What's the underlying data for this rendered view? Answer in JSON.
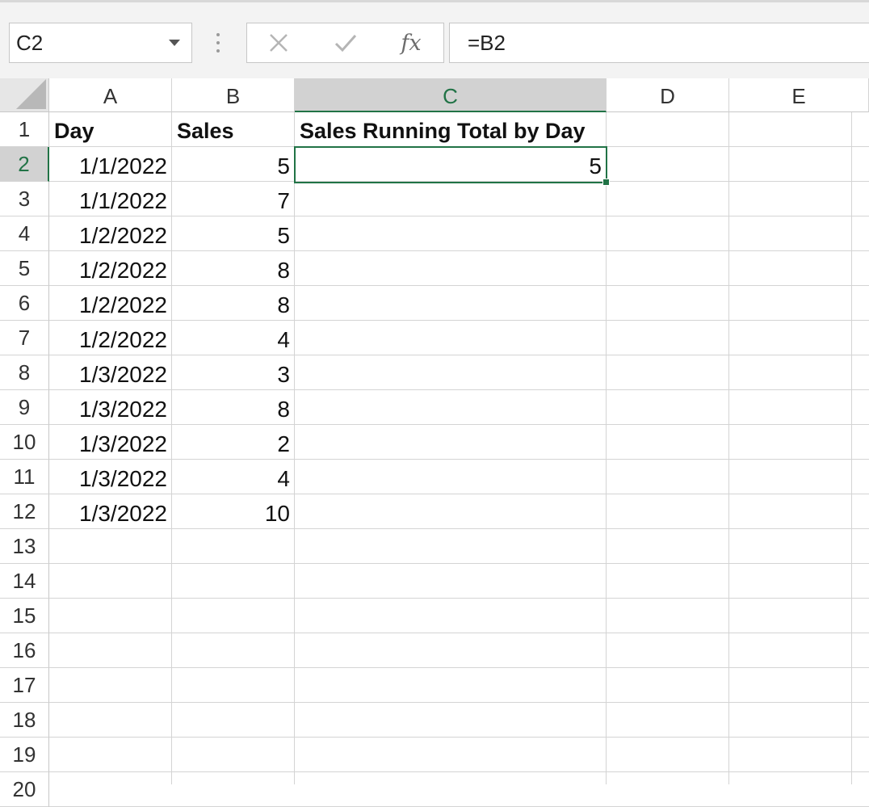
{
  "name_box": {
    "value": "C2"
  },
  "formula_bar": {
    "cancel_icon": "x-icon",
    "enter_icon": "check-icon",
    "fx_label": "fx",
    "formula": "=B2"
  },
  "columns": [
    "A",
    "B",
    "C",
    "D",
    "E"
  ],
  "selected_column": "C",
  "rows": [
    "1",
    "2",
    "3",
    "4",
    "5",
    "6",
    "7",
    "8",
    "9",
    "10",
    "11",
    "12",
    "13",
    "14",
    "15",
    "16",
    "17",
    "18",
    "19",
    "20"
  ],
  "selected_row": "2",
  "headers": {
    "A": "Day",
    "B": "Sales",
    "C": "Sales Running Total by Day"
  },
  "data": [
    {
      "day": "1/1/2022",
      "sales": "5",
      "total": "5"
    },
    {
      "day": "1/1/2022",
      "sales": "7",
      "total": ""
    },
    {
      "day": "1/2/2022",
      "sales": "5",
      "total": ""
    },
    {
      "day": "1/2/2022",
      "sales": "8",
      "total": ""
    },
    {
      "day": "1/2/2022",
      "sales": "8",
      "total": ""
    },
    {
      "day": "1/2/2022",
      "sales": "4",
      "total": ""
    },
    {
      "day": "1/3/2022",
      "sales": "3",
      "total": ""
    },
    {
      "day": "1/3/2022",
      "sales": "8",
      "total": ""
    },
    {
      "day": "1/3/2022",
      "sales": "2",
      "total": ""
    },
    {
      "day": "1/3/2022",
      "sales": "4",
      "total": ""
    },
    {
      "day": "1/3/2022",
      "sales": "10",
      "total": ""
    }
  ],
  "accent_color": "#217346"
}
